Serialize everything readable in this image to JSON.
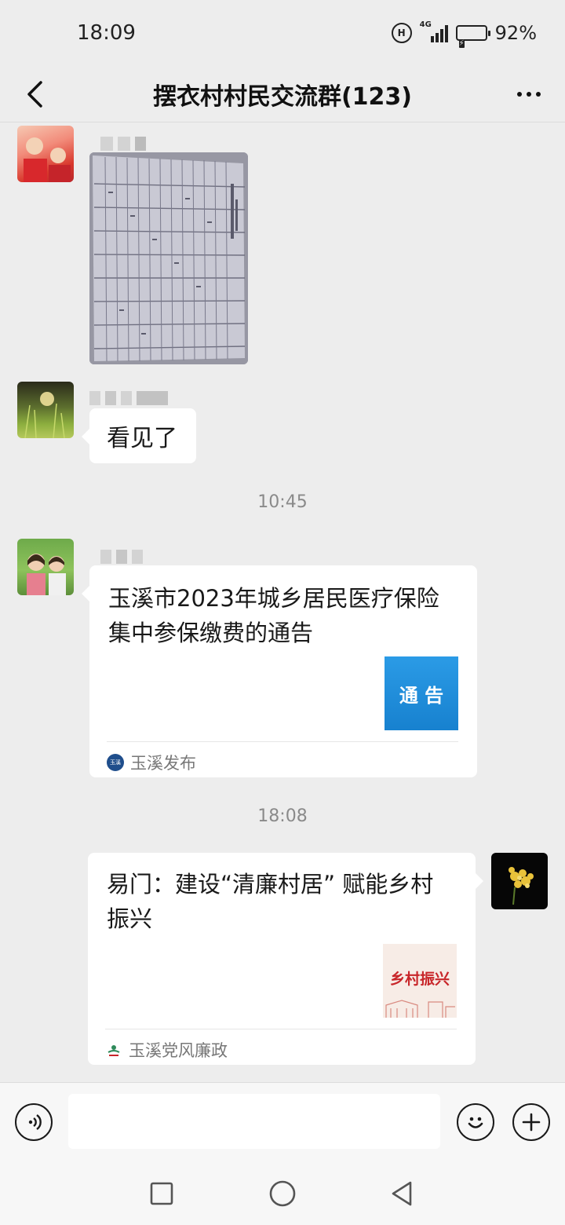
{
  "status_bar": {
    "time": "18:09",
    "network": "4G",
    "battery": "92%"
  },
  "header": {
    "title": "摆衣村村民交流群(123)"
  },
  "messages": {
    "msg1": {
      "type": "image"
    },
    "msg2": {
      "text": "看见了"
    },
    "time1": "10:45",
    "msg3": {
      "title_line1": "玉溪市2023年城乡居民医疗保险",
      "title_line2": "集中参保缴费的通告",
      "thumb_text": "通 告",
      "source_icon_text": "玉溪发布",
      "source": "玉溪发布"
    },
    "time2": "18:08",
    "msg4": {
      "title_line1": "易门：建设“清廉村居” 赋能乡村",
      "title_line2": "振兴",
      "thumb_text": "乡村振兴",
      "source": "玉溪党风廉政"
    }
  },
  "input": {
    "placeholder": ""
  },
  "colors": {
    "background": "#ededed",
    "bubble": "#ffffff",
    "notice_blue": "#1a8bd8",
    "slogan_red": "#c8262a"
  }
}
